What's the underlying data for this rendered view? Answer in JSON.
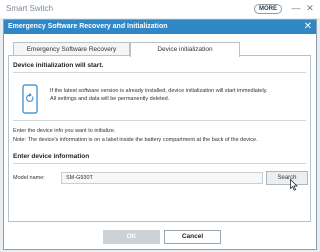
{
  "app": {
    "title": "Smart Switch",
    "more_label": "MORE",
    "minimize_glyph": "—",
    "close_glyph": "✕"
  },
  "dialog": {
    "title": "Emergency Software Recovery and Initialization",
    "close_glyph": "✕",
    "tabs": [
      {
        "label": "Emergency Software Recovery",
        "selected": false
      },
      {
        "label": "Device initialization",
        "selected": true
      }
    ],
    "section_heading": "Device initialization will start.",
    "info_line1": "If the latest software version is already installed, device initialization will start immediately.",
    "info_line2": "All settings and data will be permanently deleted.",
    "enter_info": "Enter the device info you want to initialize.",
    "note": "Note: The device's information is on a label inside the battery compartment at the back of the device.",
    "enter_heading": "Enter device information",
    "model_label": "Model name:",
    "model_value": "SM-G930T",
    "search_label": "Search",
    "ok_label": "OK",
    "cancel_label": "Cancel"
  },
  "colors": {
    "accent": "#2f87c6",
    "ok_disabled": "#cdd2d6"
  },
  "icons": [
    "phone-refresh-icon",
    "mouse-cursor-icon",
    "minimize-icon",
    "close-icon"
  ]
}
